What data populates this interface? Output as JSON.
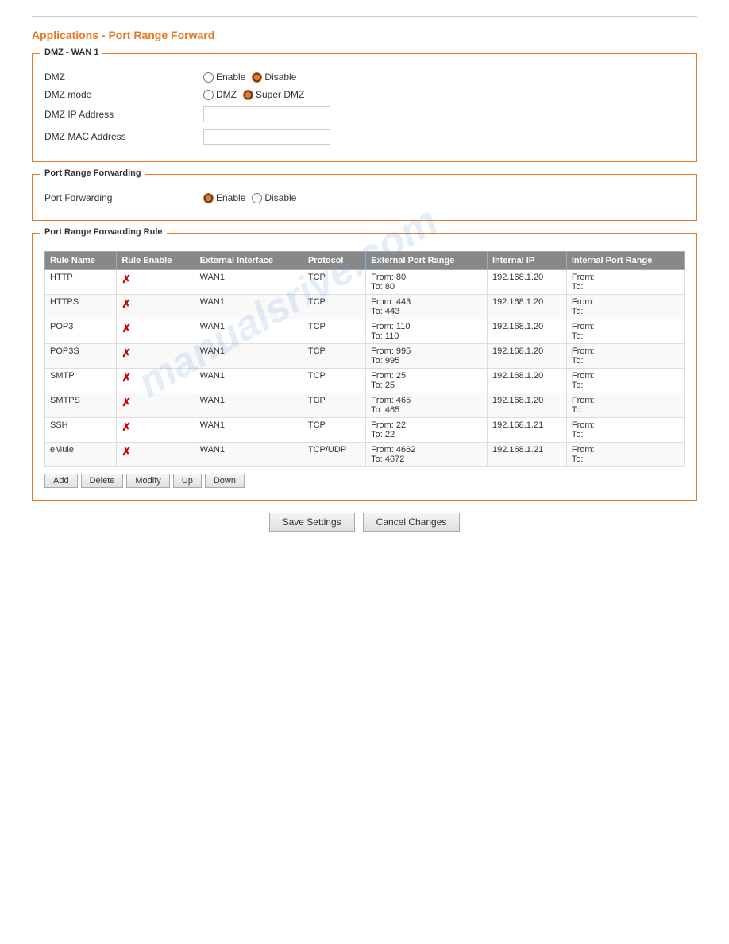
{
  "page": {
    "title": "Applications - Port Range Forward",
    "top_line": true
  },
  "dmz_section": {
    "legend": "DMZ - WAN 1",
    "fields": [
      {
        "label": "DMZ",
        "type": "radio",
        "options": [
          "Enable",
          "Disable"
        ],
        "selected": "Disable"
      },
      {
        "label": "DMZ mode",
        "type": "radio",
        "options": [
          "DMZ",
          "Super DMZ"
        ],
        "selected": "Super DMZ"
      },
      {
        "label": "DMZ IP Address",
        "type": "text",
        "value": ""
      },
      {
        "label": "DMZ MAC Address",
        "type": "text",
        "value": ""
      }
    ]
  },
  "port_forwarding_section": {
    "legend": "Port Range Forwarding",
    "label": "Port Forwarding",
    "options": [
      "Enable",
      "Disable"
    ],
    "selected": "Enable"
  },
  "rule_section": {
    "legend": "Port Range Forwarding Rule",
    "columns": [
      "Rule Name",
      "Rule Enable",
      "External Interface",
      "Protocol",
      "External Port Range",
      "Internal IP",
      "Internal Port Range"
    ],
    "rows": [
      {
        "name": "HTTP",
        "enabled": false,
        "interface": "WAN1",
        "protocol": "TCP",
        "ext_from": "From: 80",
        "ext_to": "To: 80",
        "internal_ip": "192.168.1.20",
        "int_from": "From:",
        "int_to": "To:"
      },
      {
        "name": "HTTPS",
        "enabled": false,
        "interface": "WAN1",
        "protocol": "TCP",
        "ext_from": "From: 443",
        "ext_to": "To: 443",
        "internal_ip": "192.168.1.20",
        "int_from": "From:",
        "int_to": "To:"
      },
      {
        "name": "POP3",
        "enabled": false,
        "interface": "WAN1",
        "protocol": "TCP",
        "ext_from": "From: 110",
        "ext_to": "To: 110",
        "internal_ip": "192.168.1.20",
        "int_from": "From:",
        "int_to": "To:"
      },
      {
        "name": "POP3S",
        "enabled": false,
        "interface": "WAN1",
        "protocol": "TCP",
        "ext_from": "From: 995",
        "ext_to": "To: 995",
        "internal_ip": "192.168.1.20",
        "int_from": "From:",
        "int_to": "To:"
      },
      {
        "name": "SMTP",
        "enabled": false,
        "interface": "WAN1",
        "protocol": "TCP",
        "ext_from": "From: 25",
        "ext_to": "To: 25",
        "internal_ip": "192.168.1.20",
        "int_from": "From:",
        "int_to": "To:"
      },
      {
        "name": "SMTPS",
        "enabled": false,
        "interface": "WAN1",
        "protocol": "TCP",
        "ext_from": "From: 465",
        "ext_to": "To: 465",
        "internal_ip": "192.168.1.20",
        "int_from": "From:",
        "int_to": "To:"
      },
      {
        "name": "SSH",
        "enabled": false,
        "interface": "WAN1",
        "protocol": "TCP",
        "ext_from": "From: 22",
        "ext_to": "To: 22",
        "internal_ip": "192.168.1.21",
        "int_from": "From:",
        "int_to": "To:"
      },
      {
        "name": "eMule",
        "enabled": false,
        "interface": "WAN1",
        "protocol": "TCP/UDP",
        "ext_from": "From: 4662",
        "ext_to": "To: 4672",
        "internal_ip": "192.168.1.21",
        "int_from": "From:",
        "int_to": "To:"
      }
    ],
    "buttons": [
      "Add",
      "Delete",
      "Modify",
      "Up",
      "Down"
    ]
  },
  "footer": {
    "save_label": "Save Settings",
    "cancel_label": "Cancel Changes"
  },
  "watermark": "manualsrive.com"
}
